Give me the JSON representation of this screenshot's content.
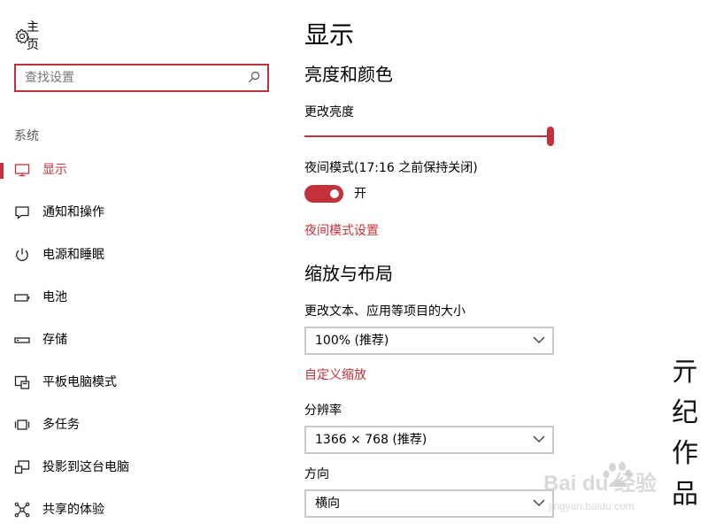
{
  "accent_color": "#c4313b",
  "sidebar": {
    "home_label": "主页",
    "home_icon": "gear-icon",
    "search": {
      "placeholder": "查找设置",
      "value": ""
    },
    "section_label": "系统",
    "items": [
      {
        "label": "显示",
        "icon": "monitor-icon",
        "active": true
      },
      {
        "label": "通知和操作",
        "icon": "speech-bubble-icon",
        "active": false
      },
      {
        "label": "电源和睡眠",
        "icon": "power-icon",
        "active": false
      },
      {
        "label": "电池",
        "icon": "battery-icon",
        "active": false
      },
      {
        "label": "存储",
        "icon": "storage-drive-icon",
        "active": false
      },
      {
        "label": "平板电脑模式",
        "icon": "tablet-mode-icon",
        "active": false
      },
      {
        "label": "多任务",
        "icon": "multitask-icon",
        "active": false
      },
      {
        "label": "投影到这台电脑",
        "icon": "project-to-pc-icon",
        "active": false
      },
      {
        "label": "共享的体验",
        "icon": "shared-experiences-icon",
        "active": false
      }
    ]
  },
  "main": {
    "title": "显示",
    "brightness_section": "亮度和颜色",
    "brightness_label": "更改亮度",
    "brightness_level": 1.0,
    "night_mode_label": "夜间模式(17:16 之前保持关闭)",
    "night_mode_state": "开",
    "night_mode_on": true,
    "night_mode_link": "夜间模式设置",
    "scale_section": "缩放与布局",
    "scale_label": "更改文本、应用等项目的大小",
    "scale_value": "100% (推荐)",
    "custom_scale_link": "自定义缩放",
    "resolution_label": "分辨率",
    "resolution_value": "1366 × 768 (推荐)",
    "orientation_label": "方向",
    "orientation_value": "横向"
  },
  "watermark": {
    "vertical_text": [
      "亓",
      "纪",
      "作",
      "品"
    ],
    "brand": "Bai du 经验",
    "site": "jingyan.baidu.com"
  }
}
